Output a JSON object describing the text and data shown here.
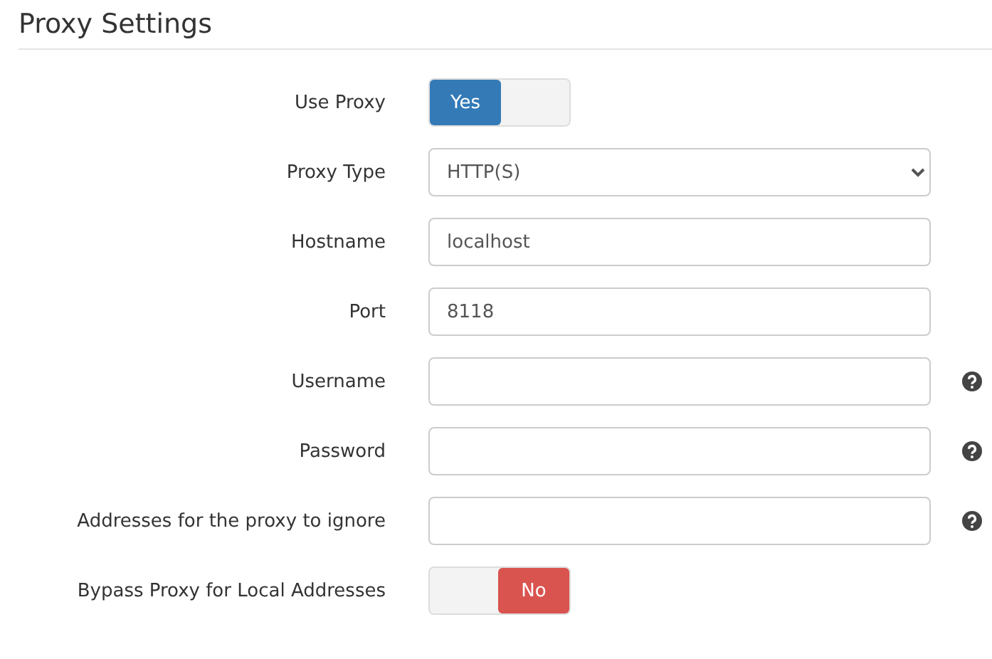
{
  "title": "Proxy Settings",
  "fields": [
    {
      "label": "Use Proxy",
      "kind": "toggle",
      "on": true,
      "text": "Yes",
      "help": false
    },
    {
      "label": "Proxy Type",
      "kind": "select",
      "value": "HTTP(S)",
      "help": false
    },
    {
      "label": "Hostname",
      "kind": "text",
      "value": "localhost",
      "help": false
    },
    {
      "label": "Port",
      "kind": "text",
      "value": "8118",
      "help": false
    },
    {
      "label": "Username",
      "kind": "text",
      "help": true
    },
    {
      "label": "Password",
      "kind": "text",
      "help": true
    },
    {
      "label": "Addresses for the proxy to ignore",
      "kind": "text",
      "help": true
    },
    {
      "label": "Bypass Proxy for Local Addresses",
      "kind": "toggle",
      "on": false,
      "text": "No",
      "help": false
    }
  ]
}
